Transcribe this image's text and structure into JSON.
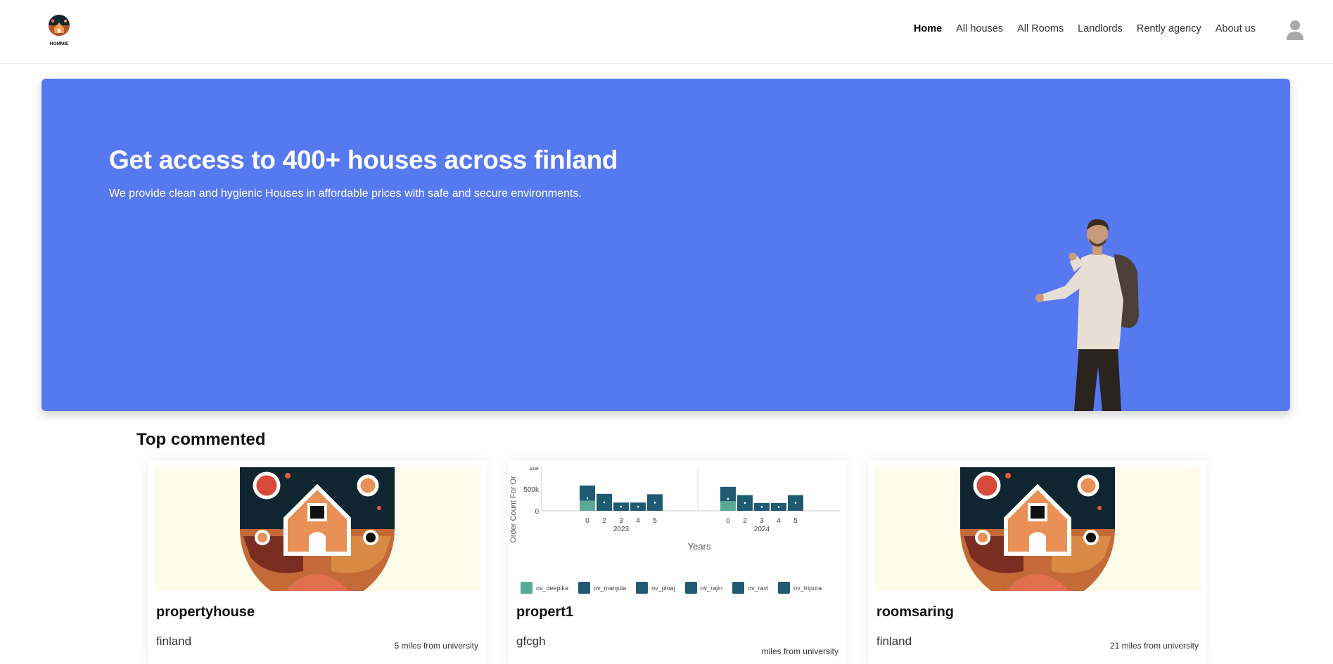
{
  "nav": {
    "logo_text": "HOMMIE",
    "links": [
      {
        "label": "Home",
        "active": true
      },
      {
        "label": "All houses",
        "active": false
      },
      {
        "label": "All Rooms",
        "active": false
      },
      {
        "label": "Landlords",
        "active": false
      },
      {
        "label": "Rently agency",
        "active": false
      },
      {
        "label": "About us",
        "active": false
      }
    ],
    "user_icon": "user-avatar-icon"
  },
  "hero": {
    "title": "Get access to 400+ houses across finland",
    "subtitle": "We provide clean and hygienic Houses in affordable prices with safe and secure environments.",
    "background": "#5779f0"
  },
  "section": {
    "title": "Top commented"
  },
  "cards": [
    {
      "title": "propertyhouse",
      "location": "finland",
      "distance": "5 miles from university"
    },
    {
      "title": "propert1",
      "location": "gfcgh",
      "distance": "miles from university"
    },
    {
      "title": "roomsaring",
      "location": "finland",
      "distance": "21 miles from university"
    }
  ],
  "chart_data": {
    "type": "bar",
    "ylabel": "Order Count For Or",
    "xlabel": "Years",
    "y_ticks": [
      "0",
      "500k",
      "1M"
    ],
    "ylim": [
      0,
      1000000
    ],
    "groups": [
      {
        "label": "2023",
        "categories": [
          "0",
          "2",
          "3",
          "4",
          "5"
        ],
        "values": [
          580000,
          390000,
          190000,
          190000,
          380000
        ]
      },
      {
        "label": "2024",
        "categories": [
          "0",
          "2",
          "3",
          "4",
          "5"
        ],
        "values": [
          550000,
          360000,
          180000,
          180000,
          360000
        ]
      }
    ],
    "legend": [
      {
        "name": "ov_deepika",
        "color": "#5aa996"
      },
      {
        "name": "ov_manjula",
        "color": "#1f5a73"
      },
      {
        "name": "ov_pinaj",
        "color": "#1f5a73"
      },
      {
        "name": "ov_rajin",
        "color": "#1f5a73"
      },
      {
        "name": "ov_ravi",
        "color": "#1f5a73"
      },
      {
        "name": "ov_tripura",
        "color": "#1f5a73"
      }
    ]
  }
}
